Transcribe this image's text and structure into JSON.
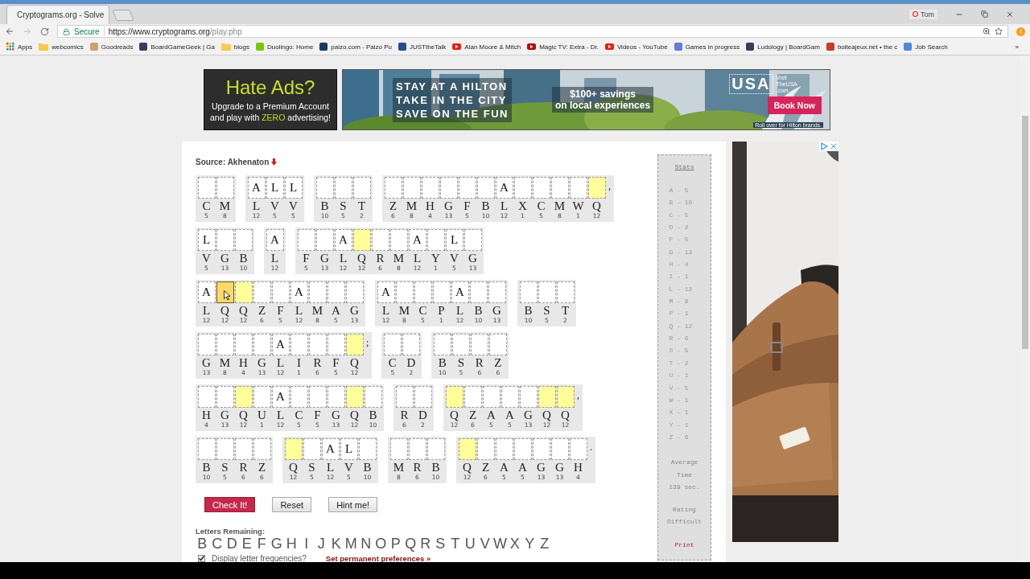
{
  "browser": {
    "tab": {
      "title": "Cryptograms.org - Solve"
    },
    "profile": "Tom",
    "address": {
      "secure_label": "Secure",
      "url_host": "https://www.cryptograms.org",
      "url_path": "/play.php"
    },
    "bookmarks": [
      {
        "label": "Apps",
        "kind": "apps"
      },
      {
        "label": "webcomics",
        "kind": "folder"
      },
      {
        "label": "Goodreads",
        "kind": "site",
        "color": "#c8a46a"
      },
      {
        "label": "BoardGameGeek | Ga",
        "kind": "site",
        "color": "#3b3b5c"
      },
      {
        "label": "blogs",
        "kind": "folder"
      },
      {
        "label": "Duolingo: Home",
        "kind": "site",
        "color": "#78c800"
      },
      {
        "label": "paizo.com - Paizo Pu",
        "kind": "site",
        "color": "#1c3a5c"
      },
      {
        "label": "JUSTtheTalk",
        "kind": "site",
        "color": "#2a4a8a"
      },
      {
        "label": "Alan Moore & Mitch",
        "kind": "video",
        "color": "#e62117"
      },
      {
        "label": "Magic TV: Extra - Dr.",
        "kind": "video",
        "color": "#b01010"
      },
      {
        "label": "Videos - YouTube",
        "kind": "video",
        "color": "#e62117"
      },
      {
        "label": "Games in progress",
        "kind": "site",
        "color": "#6a7ad8"
      },
      {
        "label": "Ludology | BoardGam",
        "kind": "site",
        "color": "#3b3b5c"
      },
      {
        "label": "boiteajeux.net • the c",
        "kind": "site",
        "color": "#c83a2a"
      },
      {
        "label": "Job Search",
        "kind": "site",
        "color": "#4a8ad8"
      }
    ],
    "more": "»"
  },
  "ads": {
    "premium": {
      "title": "Hate Ads?",
      "line_1": "Upgrade to a Premium Account",
      "line_2_before": "and play with",
      "line_2_highlight": "ZERO",
      "line_2_after": "advertising!"
    },
    "banner": {
      "headline": [
        "STAY AT A HILTON",
        "TAKE IN THE CITY",
        "SAVE ON THE FUN"
      ],
      "offer": [
        "$100+ savings",
        "on local experiences"
      ],
      "logo": "USA",
      "logo_caption": [
        "Visit",
        "TheUSA",
        ".com"
      ],
      "button": "Book Now",
      "footnote": "Roll over for Hilton brands."
    }
  },
  "puzzle": {
    "source": "Source: Akhenaton",
    "lines": [
      {
        "words": [
          {
            "cells": [
              {
                "cipher": "C",
                "count": "5",
                "highlighted": false,
                "selected": false
              },
              {
                "cipher": "M",
                "count": "8",
                "highlighted": false,
                "selected": false
              }
            ]
          },
          {
            "cells": [
              {
                "cipher": "L",
                "count": "12",
                "guess": "A",
                "highlighted": false,
                "selected": false
              },
              {
                "cipher": "V",
                "count": "5",
                "guess": "L",
                "highlighted": false,
                "selected": false
              },
              {
                "cipher": "V",
                "count": "5",
                "guess": "L",
                "highlighted": false,
                "selected": false
              }
            ]
          },
          {
            "cells": [
              {
                "cipher": "B",
                "count": "10",
                "highlighted": false,
                "selected": false
              },
              {
                "cipher": "S",
                "count": "5",
                "highlighted": false,
                "selected": false
              },
              {
                "cipher": "T",
                "count": "2",
                "highlighted": false,
                "selected": false
              }
            ]
          },
          {
            "cells": [
              {
                "cipher": "Z",
                "count": "6",
                "highlighted": false,
                "selected": false
              },
              {
                "cipher": "M",
                "count": "8",
                "highlighted": false,
                "selected": false
              },
              {
                "cipher": "H",
                "count": "4",
                "highlighted": false,
                "selected": false
              },
              {
                "cipher": "G",
                "count": "13",
                "highlighted": false,
                "selected": false
              },
              {
                "cipher": "F",
                "count": "5",
                "highlighted": false,
                "selected": false
              },
              {
                "cipher": "B",
                "count": "10",
                "highlighted": false,
                "selected": false
              },
              {
                "cipher": "L",
                "count": "12",
                "guess": "A",
                "highlighted": false,
                "selected": false
              },
              {
                "cipher": "X",
                "count": "1",
                "highlighted": false,
                "selected": false
              },
              {
                "cipher": "C",
                "count": "5",
                "highlighted": false,
                "selected": false
              },
              {
                "cipher": "M",
                "count": "8",
                "highlighted": false,
                "selected": false
              },
              {
                "cipher": "W",
                "count": "1",
                "highlighted": false,
                "selected": false
              },
              {
                "cipher": "Q",
                "count": "12",
                "highlighted": true,
                "selected": false
              }
            ],
            "punctuation": ","
          }
        ]
      },
      {
        "words": [
          {
            "cells": [
              {
                "cipher": "V",
                "count": "5",
                "guess": "L",
                "highlighted": false,
                "selected": false
              },
              {
                "cipher": "G",
                "count": "13",
                "highlighted": false,
                "selected": false
              },
              {
                "cipher": "B",
                "count": "10",
                "highlighted": false,
                "selected": false
              }
            ]
          },
          {
            "cells": [
              {
                "cipher": "L",
                "count": "12",
                "guess": "A",
                "highlighted": false,
                "selected": false
              }
            ]
          },
          {
            "cells": [
              {
                "cipher": "F",
                "count": "5",
                "highlighted": false,
                "selected": false
              },
              {
                "cipher": "G",
                "count": "13",
                "highlighted": false,
                "selected": false
              },
              {
                "cipher": "L",
                "count": "12",
                "guess": "A",
                "highlighted": false,
                "selected": false
              },
              {
                "cipher": "Q",
                "count": "12",
                "highlighted": true,
                "selected": false
              },
              {
                "cipher": "R",
                "count": "6",
                "highlighted": false,
                "selected": false
              },
              {
                "cipher": "M",
                "count": "8",
                "highlighted": false,
                "selected": false
              },
              {
                "cipher": "L",
                "count": "12",
                "guess": "A",
                "highlighted": false,
                "selected": false
              },
              {
                "cipher": "Y",
                "count": "1",
                "highlighted": false,
                "selected": false
              },
              {
                "cipher": "V",
                "count": "5",
                "guess": "L",
                "highlighted": false,
                "selected": false
              },
              {
                "cipher": "G",
                "count": "13",
                "highlighted": false,
                "selected": false
              }
            ]
          }
        ]
      },
      {
        "words": [
          {
            "cells": [
              {
                "cipher": "L",
                "count": "12",
                "guess": "A",
                "highlighted": false,
                "selected": false
              },
              {
                "cipher": "Q",
                "count": "12",
                "highlighted": true,
                "selected": true
              },
              {
                "cipher": "Q",
                "count": "12",
                "highlighted": true,
                "selected": false
              },
              {
                "cipher": "Z",
                "count": "6",
                "highlighted": false,
                "selected": false
              },
              {
                "cipher": "F",
                "count": "5",
                "highlighted": false,
                "selected": false
              },
              {
                "cipher": "L",
                "count": "12",
                "guess": "A",
                "highlighted": false,
                "selected": false
              },
              {
                "cipher": "M",
                "count": "8",
                "highlighted": false,
                "selected": false
              },
              {
                "cipher": "A",
                "count": "5",
                "highlighted": false,
                "selected": false
              },
              {
                "cipher": "G",
                "count": "13",
                "highlighted": false,
                "selected": false
              }
            ]
          },
          {
            "cells": [
              {
                "cipher": "L",
                "count": "12",
                "guess": "A",
                "highlighted": false,
                "selected": false
              },
              {
                "cipher": "M",
                "count": "8",
                "highlighted": false,
                "selected": false
              },
              {
                "cipher": "C",
                "count": "5",
                "highlighted": false,
                "selected": false
              },
              {
                "cipher": "P",
                "count": "1",
                "highlighted": false,
                "selected": false
              },
              {
                "cipher": "L",
                "count": "12",
                "guess": "A",
                "highlighted": false,
                "selected": false
              },
              {
                "cipher": "B",
                "count": "10",
                "highlighted": false,
                "selected": false
              },
              {
                "cipher": "G",
                "count": "13",
                "highlighted": false,
                "selected": false
              }
            ]
          },
          {
            "cells": [
              {
                "cipher": "B",
                "count": "10",
                "highlighted": false,
                "selected": false
              },
              {
                "cipher": "S",
                "count": "5",
                "highlighted": false,
                "selected": false
              },
              {
                "cipher": "T",
                "count": "2",
                "highlighted": false,
                "selected": false
              }
            ]
          }
        ]
      },
      {
        "words": [
          {
            "cells": [
              {
                "cipher": "G",
                "count": "13",
                "highlighted": false,
                "selected": false
              },
              {
                "cipher": "M",
                "count": "8",
                "highlighted": false,
                "selected": false
              },
              {
                "cipher": "H",
                "count": "4",
                "highlighted": false,
                "selected": false
              },
              {
                "cipher": "G",
                "count": "13",
                "highlighted": false,
                "selected": false
              },
              {
                "cipher": "L",
                "count": "12",
                "guess": "A",
                "highlighted": false,
                "selected": false
              },
              {
                "cipher": "I",
                "count": "1",
                "highlighted": false,
                "selected": false
              },
              {
                "cipher": "R",
                "count": "6",
                "highlighted": false,
                "selected": false
              },
              {
                "cipher": "F",
                "count": "5",
                "highlighted": false,
                "selected": false
              },
              {
                "cipher": "Q",
                "count": "12",
                "highlighted": true,
                "selected": false
              }
            ],
            "punctuation": ";"
          },
          {
            "cells": [
              {
                "cipher": "C",
                "count": "5",
                "highlighted": false,
                "selected": false
              },
              {
                "cipher": "D",
                "count": "2",
                "highlighted": false,
                "selected": false
              }
            ]
          },
          {
            "cells": [
              {
                "cipher": "B",
                "count": "10",
                "highlighted": false,
                "selected": false
              },
              {
                "cipher": "S",
                "count": "5",
                "highlighted": false,
                "selected": false
              },
              {
                "cipher": "R",
                "count": "6",
                "highlighted": false,
                "selected": false
              },
              {
                "cipher": "Z",
                "count": "6",
                "highlighted": false,
                "selected": false
              }
            ]
          }
        ]
      },
      {
        "words": [
          {
            "cells": [
              {
                "cipher": "H",
                "count": "4",
                "highlighted": false,
                "selected": false
              },
              {
                "cipher": "G",
                "count": "13",
                "highlighted": false,
                "selected": false
              },
              {
                "cipher": "Q",
                "count": "12",
                "highlighted": true,
                "selected": false
              },
              {
                "cipher": "U",
                "count": "1",
                "highlighted": false,
                "selected": false
              },
              {
                "cipher": "L",
                "count": "12",
                "guess": "A",
                "highlighted": false,
                "selected": false
              },
              {
                "cipher": "C",
                "count": "5",
                "highlighted": false,
                "selected": false
              },
              {
                "cipher": "F",
                "count": "5",
                "highlighted": false,
                "selected": false
              },
              {
                "cipher": "G",
                "count": "13",
                "highlighted": false,
                "selected": false
              },
              {
                "cipher": "Q",
                "count": "12",
                "highlighted": true,
                "selected": false
              },
              {
                "cipher": "B",
                "count": "10",
                "highlighted": false,
                "selected": false
              }
            ]
          },
          {
            "cells": [
              {
                "cipher": "R",
                "count": "6",
                "highlighted": false,
                "selected": false
              },
              {
                "cipher": "D",
                "count": "2",
                "highlighted": false,
                "selected": false
              }
            ]
          },
          {
            "cells": [
              {
                "cipher": "Q",
                "count": "12",
                "highlighted": true,
                "selected": false
              },
              {
                "cipher": "Z",
                "count": "6",
                "highlighted": false,
                "selected": false
              },
              {
                "cipher": "A",
                "count": "5",
                "highlighted": false,
                "selected": false
              },
              {
                "cipher": "A",
                "count": "5",
                "highlighted": false,
                "selected": false
              },
              {
                "cipher": "G",
                "count": "13",
                "highlighted": false,
                "selected": false
              },
              {
                "cipher": "Q",
                "count": "12",
                "highlighted": true,
                "selected": false
              },
              {
                "cipher": "Q",
                "count": "12",
                "highlighted": true,
                "selected": false
              }
            ],
            "punctuation": ","
          }
        ]
      },
      {
        "words": [
          {
            "cells": [
              {
                "cipher": "B",
                "count": "10",
                "highlighted": false,
                "selected": false
              },
              {
                "cipher": "S",
                "count": "5",
                "highlighted": false,
                "selected": false
              },
              {
                "cipher": "R",
                "count": "6",
                "highlighted": false,
                "selected": false
              },
              {
                "cipher": "Z",
                "count": "6",
                "highlighted": false,
                "selected": false
              }
            ]
          },
          {
            "cells": [
              {
                "cipher": "Q",
                "count": "12",
                "highlighted": true,
                "selected": false
              },
              {
                "cipher": "S",
                "count": "5",
                "highlighted": false,
                "selected": false
              },
              {
                "cipher": "L",
                "count": "12",
                "guess": "A",
                "highlighted": false,
                "selected": false
              },
              {
                "cipher": "V",
                "count": "5",
                "guess": "L",
                "highlighted": false,
                "selected": false
              },
              {
                "cipher": "B",
                "count": "10",
                "highlighted": false,
                "selected": false
              }
            ]
          },
          {
            "cells": [
              {
                "cipher": "M",
                "count": "8",
                "highlighted": false,
                "selected": false
              },
              {
                "cipher": "R",
                "count": "6",
                "highlighted": false,
                "selected": false
              },
              {
                "cipher": "B",
                "count": "10",
                "highlighted": false,
                "selected": false
              }
            ]
          },
          {
            "cells": [
              {
                "cipher": "Q",
                "count": "12",
                "highlighted": true,
                "selected": false
              },
              {
                "cipher": "Z",
                "count": "6",
                "highlighted": false,
                "selected": false
              },
              {
                "cipher": "A",
                "count": "5",
                "highlighted": false,
                "selected": false
              },
              {
                "cipher": "A",
                "count": "5",
                "highlighted": false,
                "selected": false
              },
              {
                "cipher": "G",
                "count": "13",
                "highlighted": false,
                "selected": false
              },
              {
                "cipher": "G",
                "count": "13",
                "highlighted": false,
                "selected": false
              },
              {
                "cipher": "H",
                "count": "4",
                "highlighted": false,
                "selected": false
              }
            ],
            "punctuation": "."
          }
        ]
      }
    ],
    "buttons": [
      {
        "label": "Check It!",
        "kind": "primary"
      },
      {
        "label": "Reset",
        "kind": "secondary"
      },
      {
        "label": "Hint me!",
        "kind": "secondary"
      }
    ],
    "letters_label": "Letters Remaining:",
    "letters": [
      "B",
      "C",
      "D",
      "E",
      "F",
      "G",
      "H",
      "I",
      "J",
      "K",
      "M",
      "N",
      "O",
      "P",
      "Q",
      "R",
      "S",
      "T",
      "U",
      "V",
      "W",
      "X",
      "Y",
      "Z"
    ],
    "frequency_option": {
      "label": "Display letter frequencies?",
      "checked": true
    },
    "preferences_link": "Set permanent preferences »"
  },
  "stats": {
    "title": "Stats",
    "frequencies": [
      "A - 5",
      "B - 10",
      "C - 5",
      "D - 2",
      "F - 5",
      "G - 13",
      "H - 4",
      "I - 1",
      "L - 12",
      "M - 8",
      "P - 1",
      "Q - 12",
      "R - 6",
      "S - 5",
      "T - 2",
      "U - 1",
      "V - 5",
      "W - 1",
      "X - 1",
      "Y - 1",
      "Z - 6"
    ],
    "average_label": [
      "Average",
      "Time"
    ],
    "average": "139 sec.",
    "rating_label": "Rating",
    "rating": "Difficult",
    "print": "Print"
  }
}
